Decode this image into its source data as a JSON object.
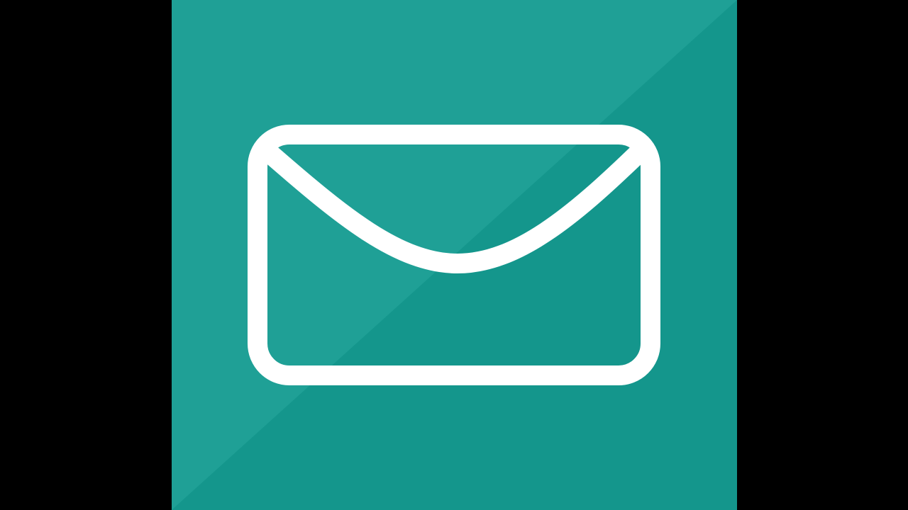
{
  "colors": {
    "letterbox": "#000000",
    "tile_light": "#1fa096",
    "tile_dark": "#14968c",
    "icon_stroke": "#ffffff"
  },
  "icon": {
    "name": "envelope-icon"
  }
}
